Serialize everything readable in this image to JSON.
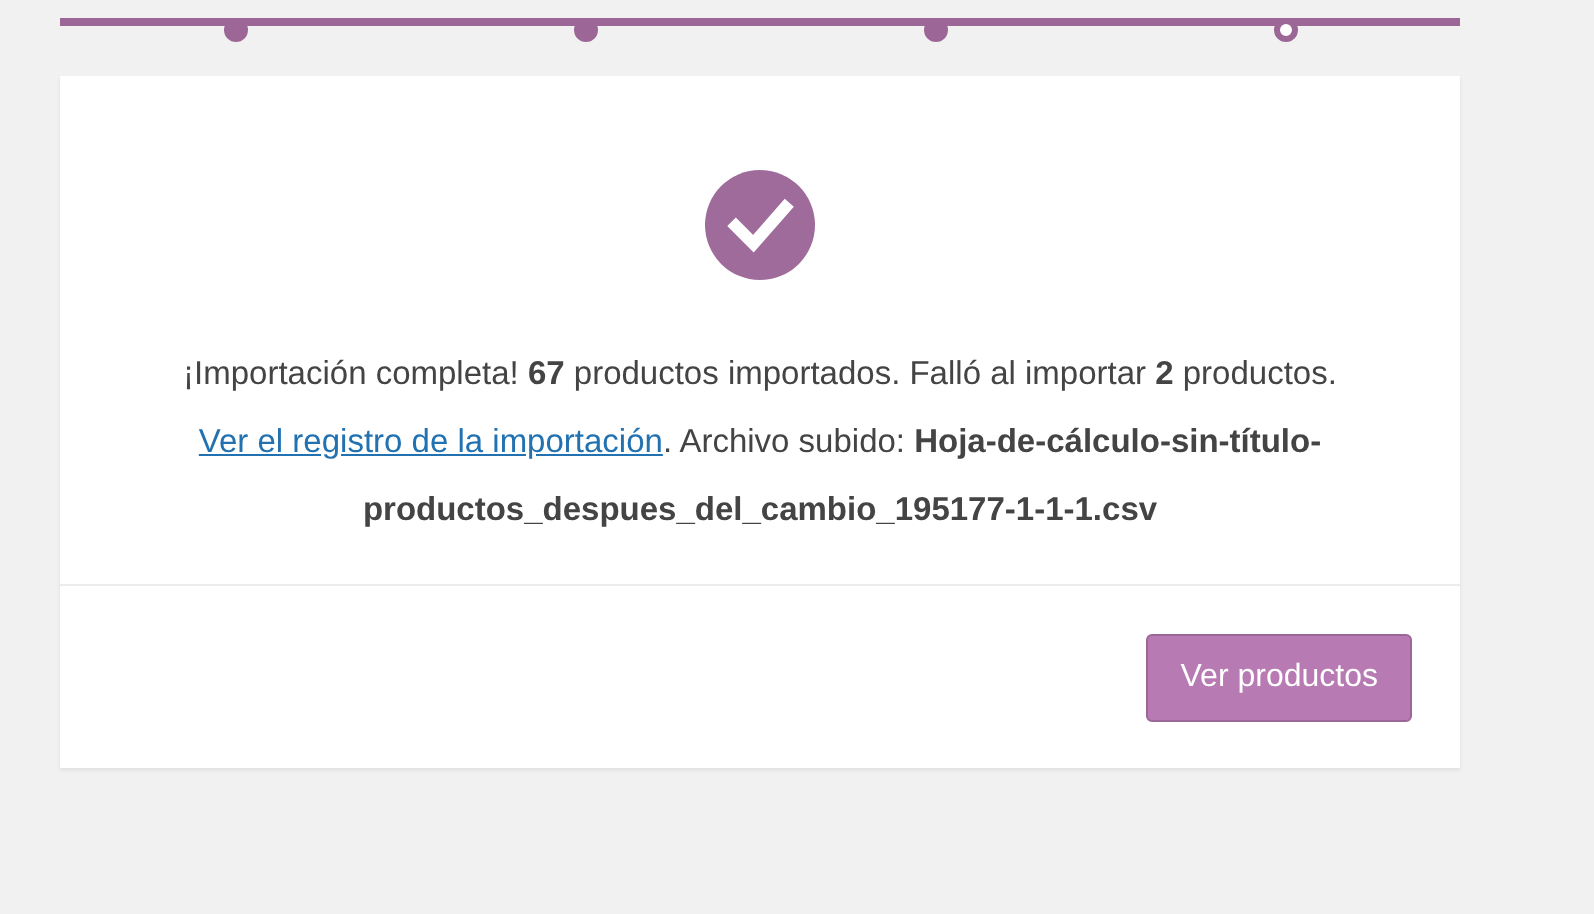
{
  "steps": [
    {
      "selected": false
    },
    {
      "selected": false
    },
    {
      "selected": false
    },
    {
      "selected": true
    }
  ],
  "message": {
    "before": "¡Importación completa! **67** productos importados. Falló al importar **2** productos.",
    "link": "Ver el registro de la importación",
    "after": ". Archivo subido: **Hoja-de-cálculo-sin-título-productos_despues_del_cambio_195177-1-1-1.csv**"
  },
  "button": "Ver productos"
}
